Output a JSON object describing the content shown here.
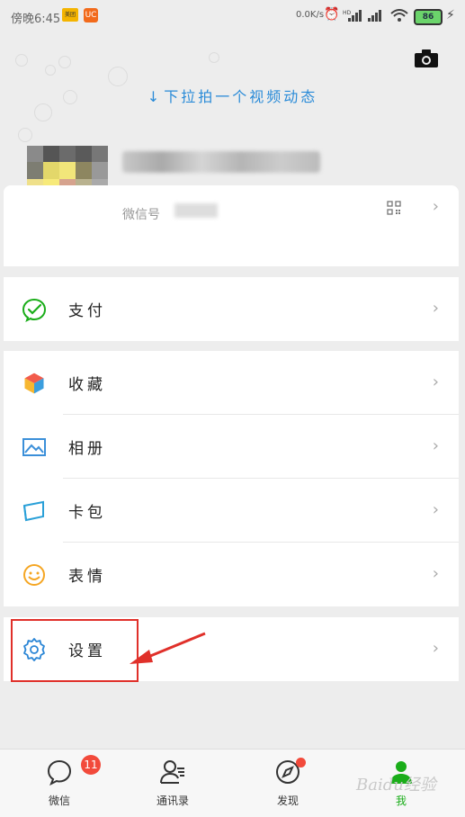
{
  "status_bar": {
    "time": "傍晚6:45",
    "app1_badge": "美团",
    "app2_badge": "UC",
    "net_speed": "0.0K/s",
    "battery": "86"
  },
  "header": {
    "pull_hint": "下拉拍一个视频动态"
  },
  "profile": {
    "wechat_id_label": "微信号"
  },
  "menu": {
    "pay": "支付",
    "favorites": "收藏",
    "album": "相册",
    "card_pack": "卡包",
    "stickers": "表情",
    "settings": "设置"
  },
  "tabbar": {
    "chats": "微信",
    "chats_badge": "11",
    "contacts": "通讯录",
    "discover": "发现",
    "me": "我"
  },
  "watermark": "Baidu经验",
  "colors": {
    "accent_blue": "#2a8bd8",
    "wechat_green": "#1aad19",
    "badge_red": "#f24a3b",
    "highlight_red": "#e0302a"
  }
}
